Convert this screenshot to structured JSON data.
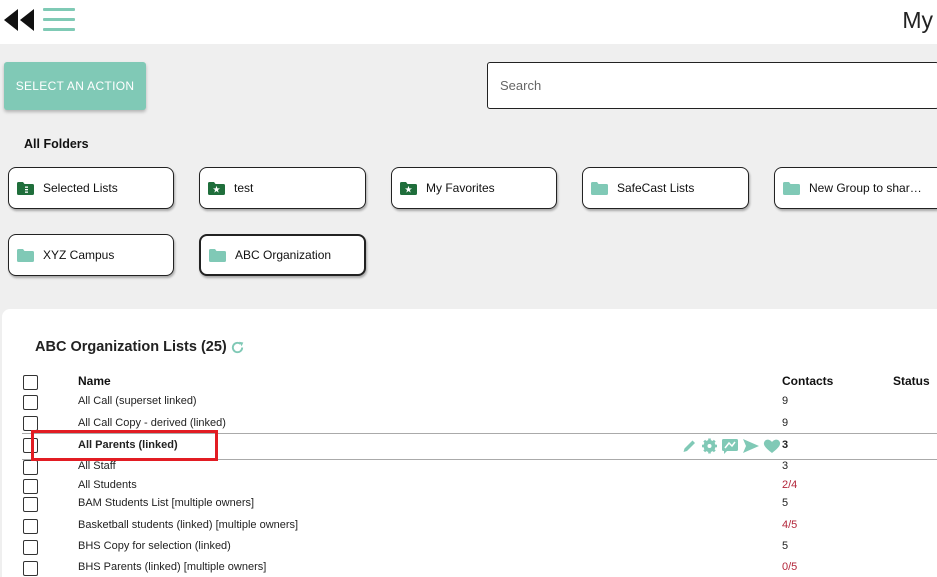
{
  "header": {
    "title": "My"
  },
  "toolbar": {
    "action_label": "SELECT AN ACTION",
    "search_placeholder": "Search"
  },
  "folders": {
    "label": "All Folders",
    "items": [
      {
        "name": "Selected Lists",
        "icon": "folder-list-icon"
      },
      {
        "name": "test",
        "icon": "folder-star-icon"
      },
      {
        "name": "My Favorites",
        "icon": "folder-star-icon"
      },
      {
        "name": "SafeCast Lists",
        "icon": "folder-icon"
      },
      {
        "name": "New Group to share with others",
        "icon": "folder-icon"
      },
      {
        "name": "XYZ Campus",
        "icon": "folder-icon"
      },
      {
        "name": "ABC Organization",
        "icon": "folder-icon",
        "active": true
      }
    ]
  },
  "lists": {
    "title": "ABC Organization Lists (25)",
    "columns": {
      "name": "Name",
      "contacts": "Contacts",
      "status": "Status"
    },
    "rows": [
      {
        "name": "All Call (superset linked)",
        "contacts": "9"
      },
      {
        "name": "All Call Copy - derived (linked)",
        "contacts": "9"
      },
      {
        "name": "All Parents (linked)",
        "contacts": "3",
        "selected": true
      },
      {
        "name": "All Staff",
        "contacts": "3"
      },
      {
        "name": "All Students",
        "contacts": "2/4",
        "warn": true
      },
      {
        "name": "BAM Students List [multiple owners]",
        "contacts": "5"
      },
      {
        "name": "Basketball students (linked) [multiple owners]",
        "contacts": "4/5",
        "warn": true
      },
      {
        "name": "BHS Copy for selection (linked)",
        "contacts": "5"
      },
      {
        "name": "BHS Parents (linked) [multiple owners]",
        "contacts": "0/5",
        "warn": true
      }
    ],
    "row_actions": [
      "edit-icon",
      "settings-icon",
      "message-icon",
      "send-icon",
      "favorite-icon"
    ]
  },
  "colors": {
    "accent": "#80c9b6",
    "warn": "#b3263a",
    "highlight": "#e21c23",
    "folder_dark": "#1f6e3b"
  }
}
